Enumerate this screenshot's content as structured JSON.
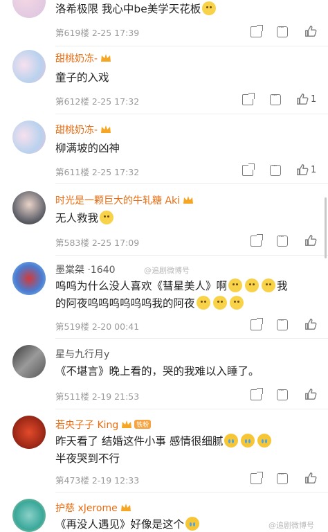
{
  "comments": [
    {
      "name": "",
      "text": "洛希极限  我心中be美学天花板",
      "emoji_after": 1,
      "floor": "第619楼",
      "time": "2-25 17:39",
      "likes": ""
    },
    {
      "name": "甜桃奶冻-",
      "text": "童子的入戏",
      "floor": "第612楼",
      "time": "2-25 17:32",
      "likes": "1"
    },
    {
      "name": "甜桃奶冻-",
      "text": "柳满坡的凶神",
      "floor": "第611楼",
      "time": "2-25 17:32",
      "likes": "1"
    },
    {
      "name": "时光是一颗巨大的牛轧糖 Aki",
      "text": "无人救我",
      "floor": "第583楼",
      "time": "2-25 17:09",
      "likes": ""
    },
    {
      "name": "墨棠桀 ·1640",
      "line1": "呜呜为什么没人喜欢《彗星美人》啊",
      "line1b": "我",
      "line2": "的阿夜呜呜呜呜呜呜我的阿夜",
      "floor": "第519楼",
      "time": "2-20 00:41",
      "likes": ""
    },
    {
      "name": "星与九行月y",
      "text": "《不堪言》晚上看的，哭的我难以入睡了。",
      "floor": "第511楼",
      "time": "2-19 21:53",
      "likes": ""
    },
    {
      "name": "若央子子 King",
      "badge": "铁粉",
      "line1": "昨天看了 结婚这件小事 感情很细腻",
      "line2": "半夜哭到不行",
      "floor": "第473楼",
      "time": "2-19 12:33",
      "likes": ""
    },
    {
      "name": "护慈 xJerome",
      "text": "《再没人遇见》好像是这个",
      "floor": "",
      "time": "",
      "likes": ""
    }
  ],
  "watermarks": [
    "@追剧微博号",
    "@追剧微博号"
  ],
  "colors": {
    "vip_name": "#e86b10",
    "meta": "#9a9a9a",
    "text": "#222222"
  },
  "icons": [
    "share-icon",
    "comment-icon",
    "like-icon",
    "crown-icon"
  ]
}
